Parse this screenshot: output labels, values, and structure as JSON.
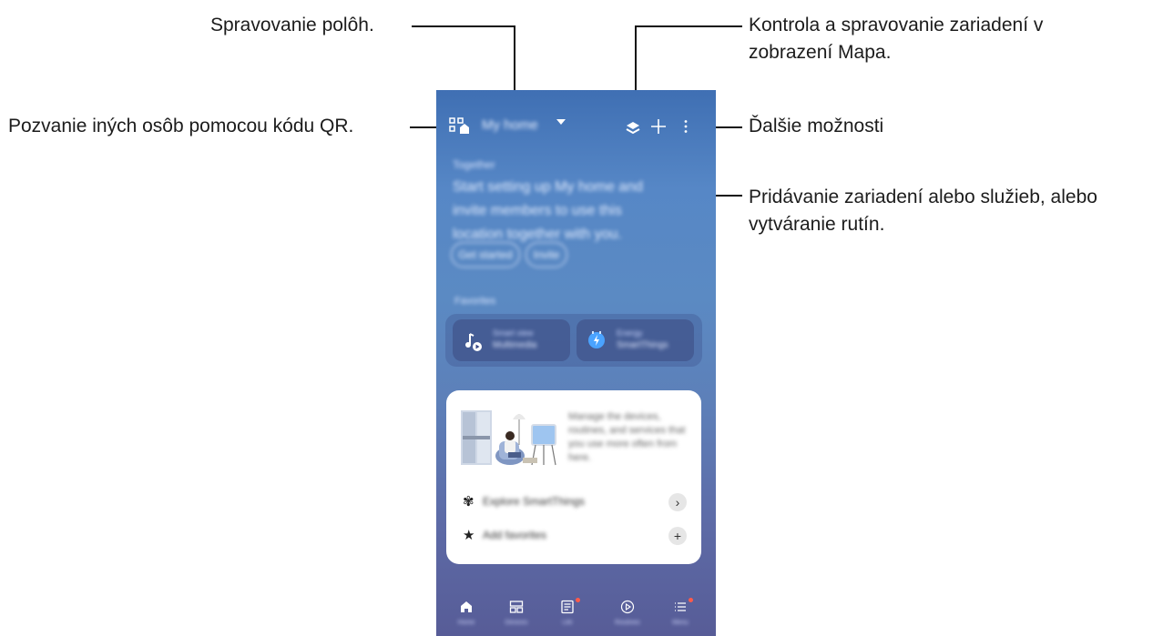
{
  "callouts": {
    "manage_places": "Spravovanie polôh.",
    "map_view": "Kontrola a spravovanie zariadení v zobrazení Mapa.",
    "map_view_line1": "Kontrola a spravovanie zariadení v",
    "map_view_line2": "zobrazení Mapa.",
    "invite_qr": "Pozvanie iných osôb pomocou kódu QR.",
    "more_options": "Ďalšie možnosti",
    "add_line1": "Pridávanie zariadení alebo služieb, alebo",
    "add_line2": "vytváranie rutín."
  },
  "app": {
    "home_name": "My home",
    "welcome_title": "Together",
    "welcome_body": "Start setting up My home and invite members to use this location together with you.",
    "pill_1": "Get started",
    "pill_2": "Invite",
    "favorites_label": "Favorites",
    "tile_1_line1": "Smart view",
    "tile_1_line2": "Multimedia",
    "tile_2_line1": "Energy",
    "tile_2_line2": "SmartThings",
    "card_desc": "Manage the devices, routines, and services that you use more often from here.",
    "row_1_label": "Explore SmartThings",
    "row_2_label": "Add favorites",
    "nav": [
      "Home",
      "Devices",
      "Life",
      "Routines",
      "Menu"
    ]
  },
  "colors": {
    "accent_dot": "#ff5a4a",
    "line": "#111111"
  }
}
